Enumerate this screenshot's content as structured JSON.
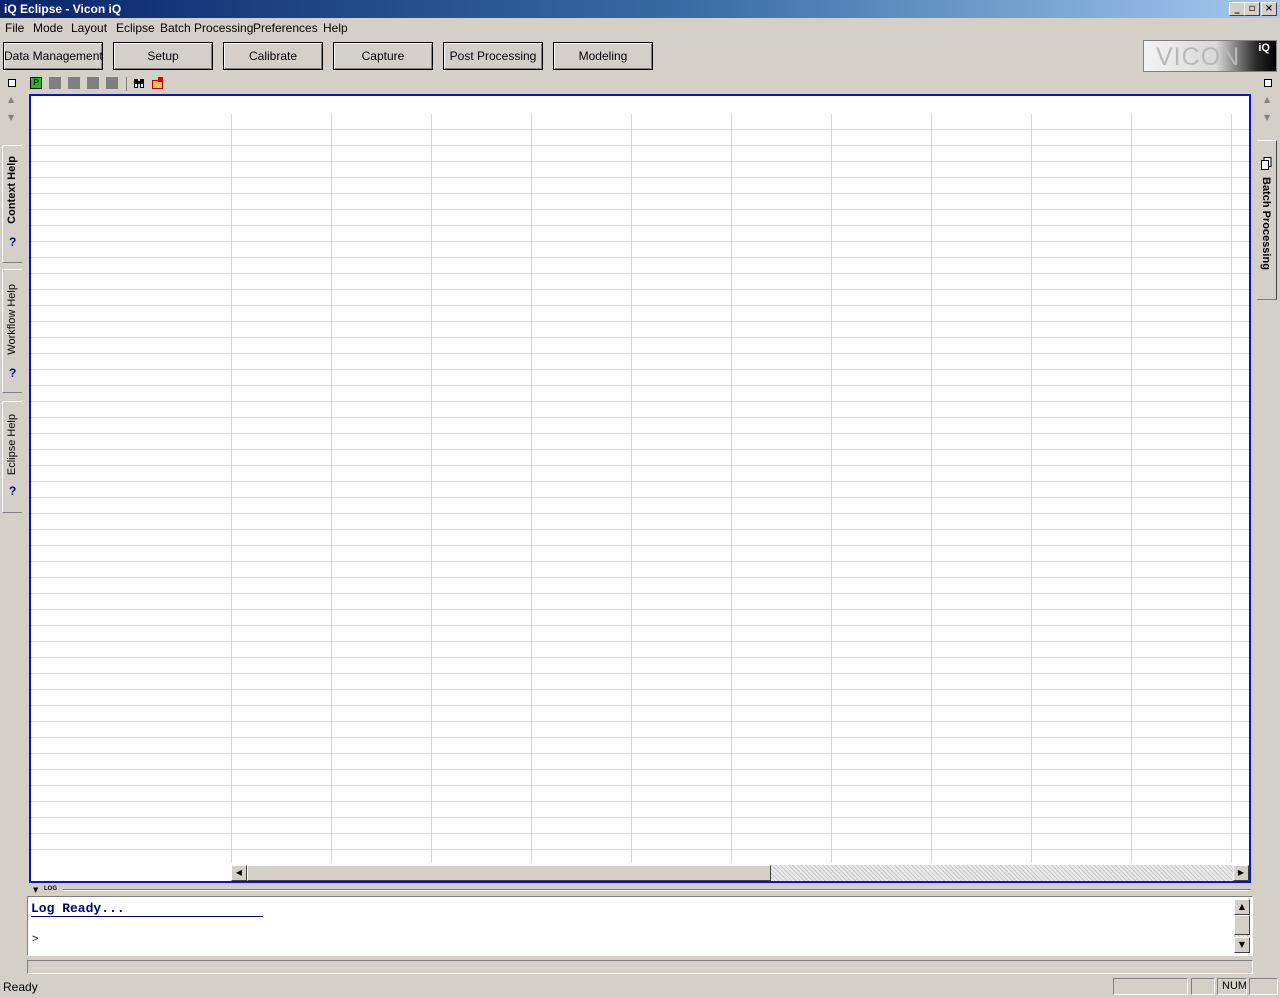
{
  "window": {
    "title": "Eclipse - Vicon iQ",
    "app_icon_text": "iQ",
    "minimize": "_",
    "restore": "▫",
    "close": "×"
  },
  "menu": [
    "File",
    "Mode",
    "Layout",
    "Eclipse",
    "Batch Processing",
    "Preferences",
    "Help"
  ],
  "mode_buttons": [
    "Data Management",
    "Setup",
    "Calibrate",
    "Capture",
    "Post Processing",
    "Modeling"
  ],
  "logo": {
    "text": "VICON",
    "badge": "iQ"
  },
  "left_panel": {
    "tabs": [
      {
        "label": "Context Help",
        "icon": "help-question-icon"
      },
      {
        "label": "Workflow Help",
        "icon": "help-question-icon"
      },
      {
        "label": "Eclipse Help",
        "icon": "help-question-icon"
      }
    ],
    "help_glyph": "?"
  },
  "right_panel": {
    "tabs": [
      {
        "label": "Batch Processing",
        "icon": "copy-pages-icon"
      }
    ]
  },
  "toolbar": {
    "icons": [
      "p-status-icon",
      "grey-square-icon",
      "grey-square-icon",
      "grey-square-icon",
      "grey-square-icon",
      "binoculars-icon",
      "new-folder-icon"
    ],
    "p_label": "P"
  },
  "log": {
    "section_label": "LOG",
    "text": "Log Ready...",
    "prompt": ">"
  },
  "status": {
    "text": "Ready",
    "num": "NUM"
  },
  "colors": {
    "title_start": "#0a246a",
    "title_end": "#a6caf0",
    "grid_border": "#1010d0",
    "log_text": "#00006a"
  }
}
